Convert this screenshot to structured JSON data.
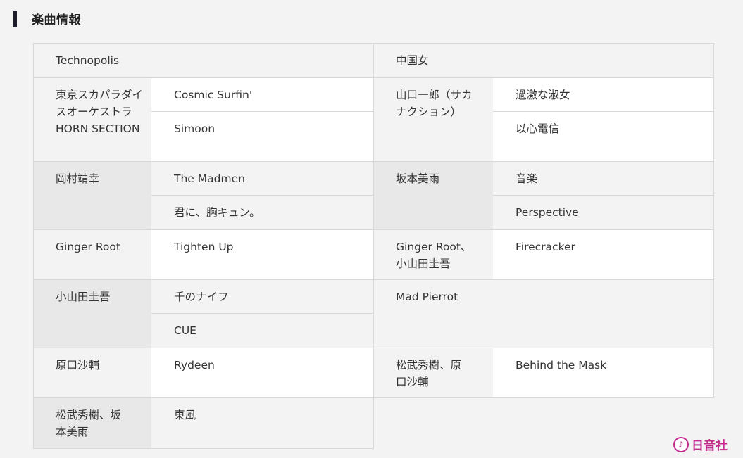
{
  "section": {
    "title": "楽曲情報"
  },
  "rows": [
    {
      "left_header": "Technopolis",
      "right_header": "中国女"
    },
    {
      "left_artist": "東京スカパラダイスオーケストラ HORN SECTION",
      "left_songs": [
        "Cosmic Surfin'",
        "Simoon"
      ],
      "right_artist": "山口一郎（サカナクション）",
      "right_songs": [
        "過激な淑女",
        "以心電信"
      ]
    },
    {
      "left_artist": "岡村靖幸",
      "left_songs": [
        "The Madmen",
        "君に、胸キュン。"
      ],
      "right_artist": "坂本美雨",
      "right_songs": [
        "音楽",
        "Perspective"
      ]
    },
    {
      "left_artist": "Ginger Root",
      "left_songs": [
        "Tighten Up"
      ],
      "right_artist": "Ginger Root、小山田圭吾",
      "right_songs": [
        "Firecracker"
      ]
    },
    {
      "left_artist": "小山田圭吾",
      "left_songs": [
        "千のナイフ",
        "CUE"
      ],
      "right_header": "Mad Pierrot"
    },
    {
      "left_artist": "原口沙輔",
      "left_songs": [
        "Rydeen"
      ],
      "right_artist": "松武秀樹、原口沙輔",
      "right_songs": [
        "Behind the Mask"
      ]
    },
    {
      "left_artist": "松武秀樹、坂本美雨",
      "left_songs": [
        "東風"
      ]
    }
  ],
  "watermark": {
    "icon": "music-note-icon",
    "text": "日音社"
  },
  "colors": {
    "accent_bar": "#1c1c2a",
    "watermark": "#c42a8c",
    "border": "#d8d8d8"
  }
}
